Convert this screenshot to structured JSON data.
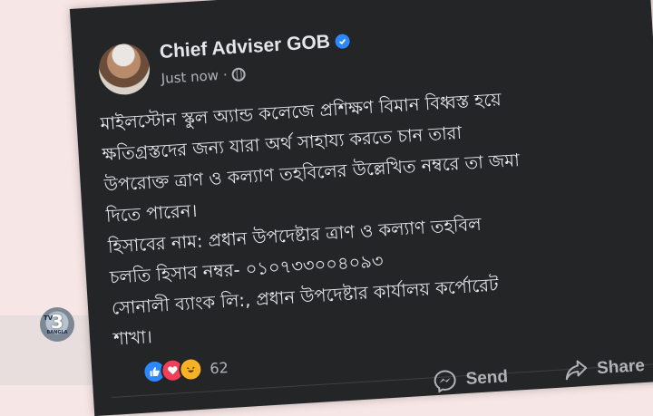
{
  "post": {
    "author": "Chief Adviser GOB",
    "time": "Just now",
    "separator": "·",
    "body_lines": [
      "মাইলস্টোন স্কুল অ্যান্ড কলেজে প্রশিক্ষণ বিমান বিধ্বস্ত হয়ে",
      "ক্ষতিগ্রস্তদের জন্য যারা অর্থ সাহায্য করতে চান তারা",
      "উপরোক্ত ত্রাণ ও কল্যাণ তহবিলের উল্লেখিত নম্বরে তা জমা",
      "দিতে পারেন।",
      "হিসাবের নাম: প্রধান উপদেষ্টার ত্রাণ ও কল্যাণ তহবিল",
      "চলতি হিসাব নম্বর- ০১০৭৩৩০০৪০৯৩",
      "সোনালী ব্যাংক লি:, প্রধান উপদেষ্টার কার্যালয় কর্পোরেট",
      "শাখা।"
    ],
    "reaction_count": "62",
    "actions": {
      "send": "Send",
      "share": "Share"
    }
  },
  "watermark": {
    "tv": "TV",
    "number": "3",
    "sub": "BANGLA"
  },
  "colors": {
    "card_bg": "#242526",
    "text": "#e4e6eb",
    "muted": "#b0b3b8",
    "verified": "#2d88ff"
  }
}
